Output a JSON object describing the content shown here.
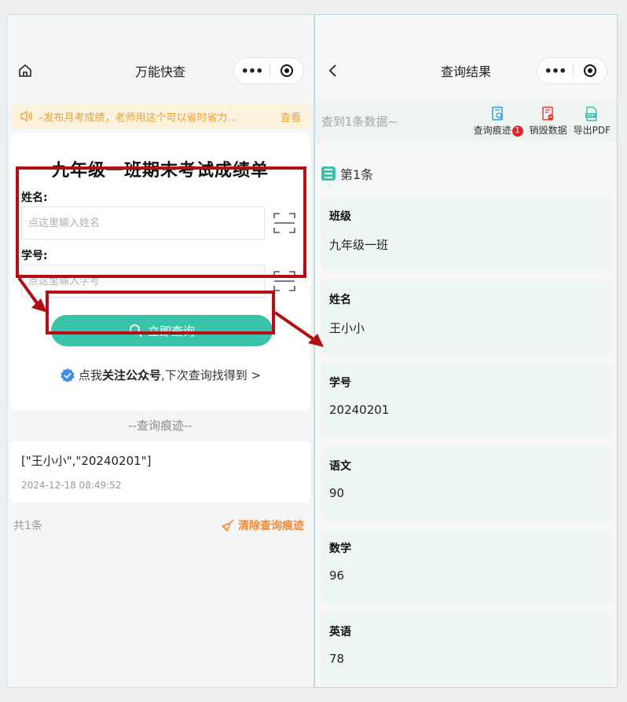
{
  "left": {
    "title": "万能快查",
    "notice": {
      "text": "–发布月考成绩，老师用这个可以省时省力...",
      "link": "查看"
    },
    "form": {
      "title": "九年级一班期末考试成绩单",
      "name_label": "姓名:",
      "name_placeholder": "点这里输入姓名",
      "id_label": "学号:",
      "id_placeholder": "点这里输入学号",
      "search_label": "立即查询",
      "follow_prefix": "点我",
      "follow_bold": "关注公众号",
      "follow_suffix": ",下次查询找得到 >"
    },
    "history": {
      "heading": "--查询痕迹--",
      "value": "[\"王小小\",\"20240201\"]",
      "time": "2024-12-18 08:49:52",
      "count": "共1条",
      "clear_label": "清除查询痕迹"
    }
  },
  "right": {
    "title": "查询结果",
    "found": "查到1条数据~",
    "tools": [
      {
        "label": "查询痕迹",
        "badge": "1",
        "icon": "search-doc-icon"
      },
      {
        "label": "销毁数据",
        "icon": "delete-doc-icon"
      },
      {
        "label": "导出PDF",
        "icon": "pdf-icon"
      }
    ],
    "record_title": "第1条",
    "fields": [
      {
        "label": "班级",
        "value": "九年级一班"
      },
      {
        "label": "姓名",
        "value": "王小小"
      },
      {
        "label": "学号",
        "value": "20240201"
      },
      {
        "label": "语文",
        "value": "90"
      },
      {
        "label": "数学",
        "value": "96"
      },
      {
        "label": "英语",
        "value": "78"
      }
    ]
  },
  "colors": {
    "accent": "#3ac3a8",
    "annotation": "#b30e14",
    "notice": "#e9a13b",
    "clear": "#ef8a3b"
  }
}
